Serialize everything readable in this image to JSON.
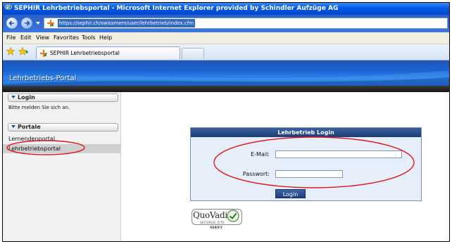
{
  "window": {
    "title": "SEPHIR Lehrbetriebsportal - Microsoft Internet Explorer provided by Schindler Aufzüge AG",
    "url": "https://sephir.ch/swissmem/user/lehrbetrieb/index.cfm"
  },
  "menu": [
    "File",
    "Edit",
    "View",
    "Favorites",
    "Tools",
    "Help"
  ],
  "tab": {
    "label": "SEPHIR Lehrbetriebsportal"
  },
  "portal": {
    "title": "Lehrbetriebs-Portal"
  },
  "sidebar": {
    "login_header": "Login",
    "login_prompt": "Bitte melden Sie sich an.",
    "portale_header": "Portale",
    "items": [
      {
        "label": "Lernendenportal",
        "active": false
      },
      {
        "label": "Lehrbetriebsportal",
        "active": true
      }
    ]
  },
  "login": {
    "header": "Lehrbetrieb Login",
    "email_label": "E-Mail:",
    "email_value": "",
    "password_label": "Passwort:",
    "password_value": "",
    "button_label": "Login"
  },
  "badge": {
    "brand": "QuoVadis",
    "subtitle": "SECURED SITE",
    "verify": "VERIFY"
  },
  "colors": {
    "titlebar": "#0058e6",
    "banner": "#1a63d2",
    "login_header": "#2a4d8f",
    "annotation": "#e0141e"
  }
}
